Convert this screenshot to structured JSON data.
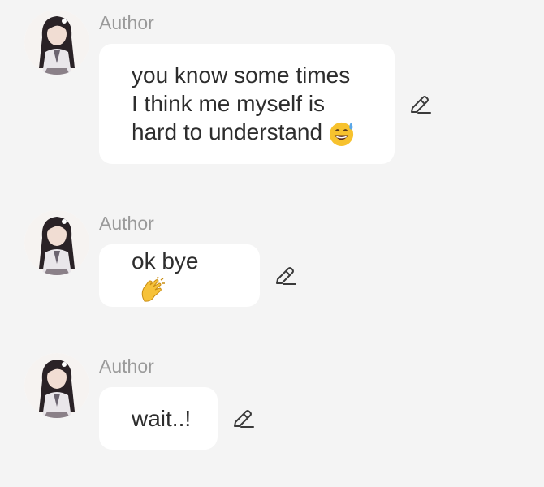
{
  "messages": [
    {
      "author": "Author",
      "text": "you know some times\nI think me myself is\nhard to understand",
      "emoji": "sweat-smile-emoji"
    },
    {
      "author": "Author",
      "text": "ok bye",
      "emoji": "clapping-hands-emoji"
    },
    {
      "author": "Author",
      "text": "wait..!",
      "emoji": ""
    }
  ],
  "icons": {
    "edit": "pencil-edit-icon",
    "avatar": "avatar"
  },
  "colors": {
    "background": "#f4f4f4",
    "bubble": "#ffffff",
    "author_text": "#9a9a9a",
    "message_text": "#2d2d2d",
    "icon": "#3a3a3a"
  }
}
